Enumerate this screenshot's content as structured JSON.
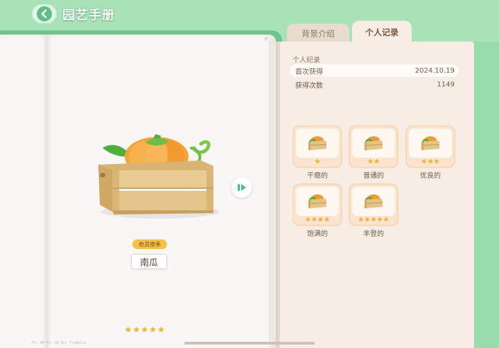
{
  "header": {
    "title": "园艺手册"
  },
  "tabs": [
    {
      "label": "背景介绍",
      "active": false
    },
    {
      "label": "个人记录",
      "active": true
    }
  ],
  "item": {
    "name": "南瓜",
    "season_badge": "奇灵夜季",
    "star_count": 5,
    "close_mark": "×"
  },
  "record": {
    "heading": "个人纪录",
    "rows": [
      {
        "label": "首次获得",
        "value": "2024.10.19"
      },
      {
        "label": "获得次数",
        "value": "1149"
      }
    ]
  },
  "qualities": [
    {
      "label": "干瘪的",
      "stars": 1
    },
    {
      "label": "普通的",
      "stars": 2
    },
    {
      "label": "优良的",
      "stars": 3
    },
    {
      "label": "饱满的",
      "stars": 4
    },
    {
      "label": "丰登的",
      "stars": 5
    }
  ],
  "footer": {
    "build_info": "Ft: 60    Fv: 60    Br: TryWhile"
  },
  "colors": {
    "accent_green": "#5fbf84",
    "star": "#f2b822",
    "badge": "#f4c24a",
    "pumpkin": "#f4a23a",
    "crate": "#e3c489"
  },
  "icons": {
    "back": "chevron-left-icon",
    "next": "play-triangle-icon",
    "star": "star-icon",
    "crate": "pumpkin-crate-icon"
  }
}
